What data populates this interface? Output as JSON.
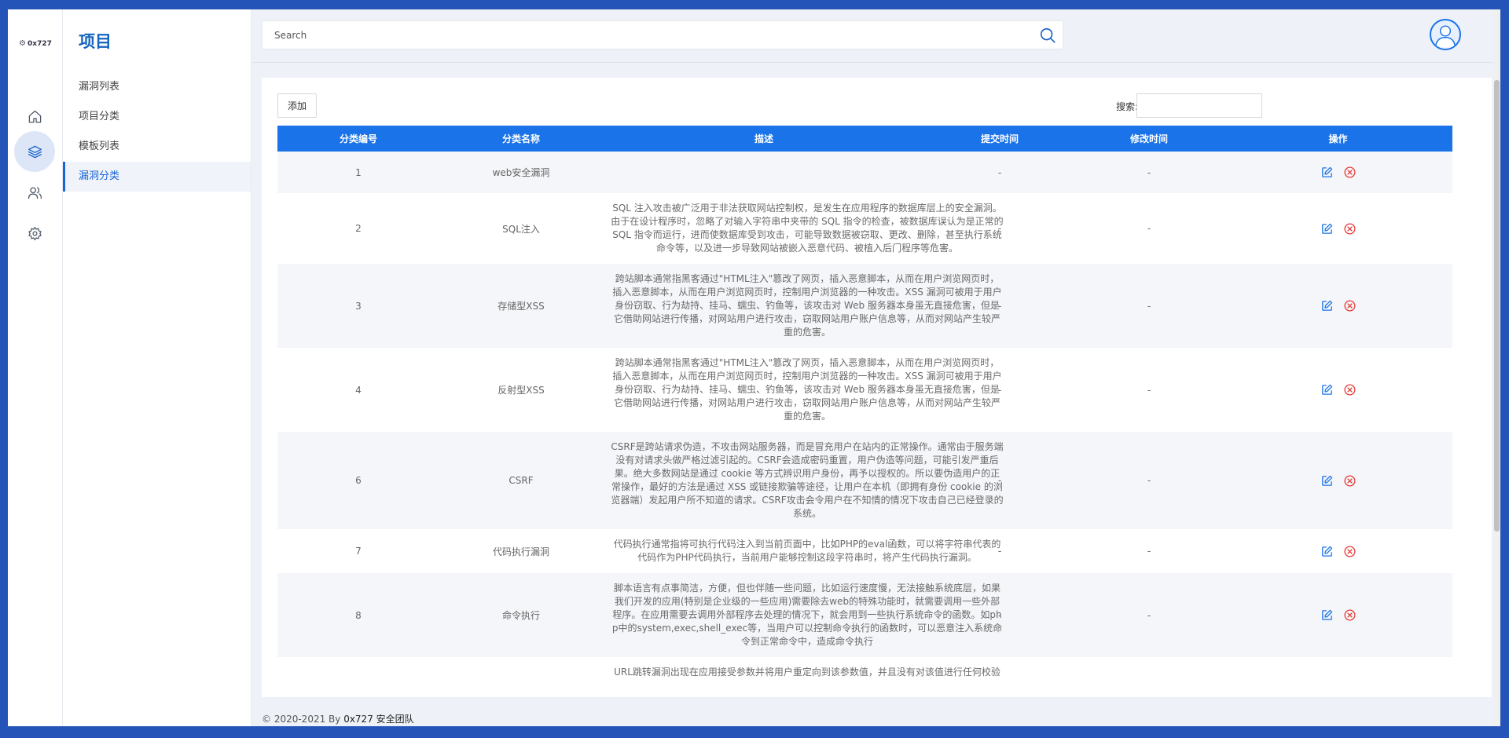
{
  "logo_text": "0x727",
  "rail": {
    "items": [
      {
        "icon": "home-icon"
      },
      {
        "icon": "layers-icon",
        "active": true
      },
      {
        "icon": "users-icon"
      },
      {
        "icon": "gear-icon"
      }
    ]
  },
  "subnav": {
    "title": "项目",
    "items": [
      {
        "label": "漏洞列表"
      },
      {
        "label": "项目分类"
      },
      {
        "label": "模板列表"
      },
      {
        "label": "漏洞分类",
        "active": true
      }
    ]
  },
  "search": {
    "placeholder": "Search"
  },
  "toolbar": {
    "add_label": "添加",
    "filter_label": "搜索:"
  },
  "table": {
    "headers": [
      "分类编号",
      "分类名称",
      "描述",
      "提交时间",
      "修改时间",
      "操作"
    ],
    "rows": [
      {
        "id": "1",
        "name": "web安全漏洞",
        "desc": "",
        "submit": "-",
        "modify": "-"
      },
      {
        "id": "2",
        "name": "SQL注入",
        "desc": "SQL 注入攻击被广泛用于非法获取网站控制权，是发生在应用程序的数据库层上的安全漏洞。由于在设计程序时，忽略了对输入字符串中夹带的 SQL 指令的检查，被数据库误认为是正常的 SQL 指令而运行，进而使数据库受到攻击，可能导致数据被窃取、更改、删除，甚至执行系统命令等，以及进一步导致网站被嵌入恶意代码、被植入后门程序等危害。",
        "submit": "-",
        "modify": "-"
      },
      {
        "id": "3",
        "name": "存储型XSS",
        "desc": "跨站脚本通常指黑客通过\"HTML注入\"篡改了网页，插入恶意脚本，从而在用户浏览网页时，插入恶意脚本，从而在用户浏览网页时，控制用户浏览器的一种攻击。XSS 漏洞可被用于用户身份窃取、行为劫持、挂马、蠕虫、钓鱼等，该攻击对 Web 服务器本身虽无直接危害，但是它借助网站进行传播，对网站用户进行攻击，窃取网站用户账户信息等，从而对网站产生较严重的危害。",
        "submit": "-",
        "modify": "-"
      },
      {
        "id": "4",
        "name": "反射型XSS",
        "desc": "跨站脚本通常指黑客通过\"HTML注入\"篡改了网页，插入恶意脚本，从而在用户浏览网页时，插入恶意脚本，从而在用户浏览网页时，控制用户浏览器的一种攻击。XSS 漏洞可被用于用户身份窃取、行为劫持、挂马、蠕虫、钓鱼等，该攻击对 Web 服务器本身虽无直接危害，但是它借助网站进行传播，对网站用户进行攻击，窃取网站用户账户信息等，从而对网站产生较严重的危害。",
        "submit": "-",
        "modify": "-"
      },
      {
        "id": "6",
        "name": "CSRF",
        "desc": "CSRF是跨站请求伪造，不攻击网站服务器，而是冒充用户在站内的正常操作。通常由于服务端没有对请求头做严格过滤引起的。CSRF会造成密码重置，用户伪造等问题，可能引发严重后果。绝大多数网站是通过 cookie 等方式辨识用户身份，再予以授权的。所以要伪造用户的正常操作，最好的方法是通过 XSS 或链接欺骗等途径，让用户在本机（即拥有身份 cookie 的浏览器端）发起用户所不知道的请求。CSRF攻击会令用户在不知情的情况下攻击自己已经登录的系统。",
        "submit": "-",
        "modify": "-"
      },
      {
        "id": "7",
        "name": "代码执行漏洞",
        "desc": "代码执行通常指将可执行代码注入到当前页面中，比如PHP的eval函数，可以将字符串代表的代码作为PHP代码执行，当前用户能够控制这段字符串时，将产生代码执行漏洞。",
        "submit": "-",
        "modify": "-"
      },
      {
        "id": "8",
        "name": "命令执行",
        "desc": "脚本语言有点事简洁，方便，但也伴随一些问题，比如运行速度慢，无法接触系统底层，如果我们开发的应用(特别是企业级的一些应用)需要除去web的特殊功能时，就需要调用一些外部程序。在应用需要去调用外部程序去处理的情况下，就会用到一些执行系统命令的函数。如php中的system,exec,shell_exec等，当用户可以控制命令执行的函数时，可以恶意注入系统命令到正常命令中，造成命令执行",
        "submit": "-",
        "modify": "-"
      },
      {
        "id": "",
        "name": "",
        "desc": "URL跳转漏洞出现在应用接受参数并将用户重定向到该参数值，并且没有对该值进行任何校验",
        "submit": "",
        "modify": ""
      }
    ]
  },
  "footer": {
    "prefix": "© 2020-2021 By ",
    "brand": "0x727 安全团队"
  },
  "colors": {
    "accent": "#1a73e8",
    "frame": "#2554b8",
    "delete": "#e53935"
  }
}
